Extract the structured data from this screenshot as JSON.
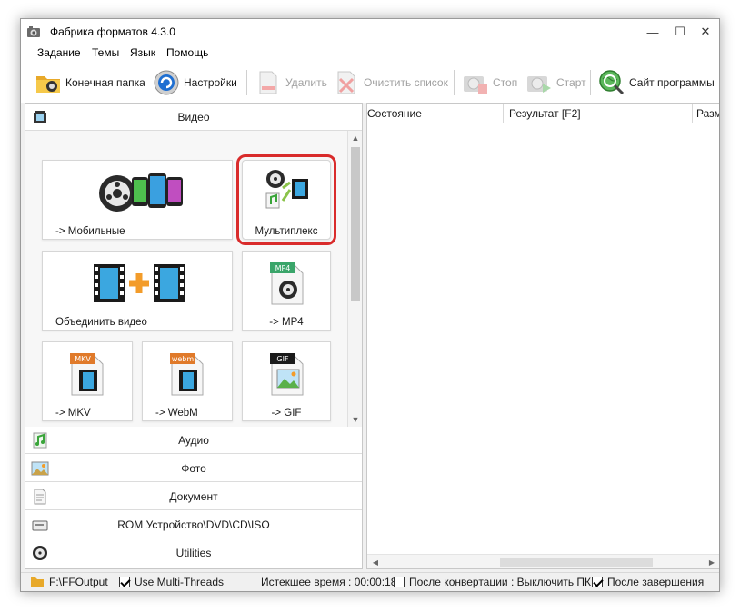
{
  "window": {
    "title": "Фабрика форматов 4.3.0",
    "controls": {
      "minimize": "—",
      "maximize": "☐",
      "close": "✕"
    }
  },
  "menu": [
    "Задание",
    "Темы",
    "Язык",
    "Помощь"
  ],
  "toolbar": {
    "output_folder": "Конечная папка",
    "settings": "Настройки",
    "delete": "Удалить",
    "clear_list": "Очистить список",
    "stop": "Стоп",
    "start": "Старт",
    "website": "Сайт программы"
  },
  "categories": {
    "video": "Видео",
    "audio": "Аудио",
    "photo": "Фото",
    "document": "Документ",
    "rom": "ROM Устройство\\DVD\\CD\\ISO",
    "utilities": "Utilities"
  },
  "video_tiles": {
    "mobile": "-> Мобильные",
    "multiplex": "Мультиплекс",
    "join": "Объединить видео",
    "mp4": "-> MP4",
    "mkv": "-> MKV",
    "webm": "-> WebM",
    "gif": "-> GIF",
    "badge_mp4": "MP4",
    "badge_mkv": "MKV",
    "badge_webm": "webm",
    "badge_gif": "GIF"
  },
  "task_columns": [
    "Состояние",
    "Результат [F2]",
    "Разм"
  ],
  "status": {
    "output_path": "F:\\FFOutput",
    "multithreads": "Use Multi-Threads",
    "elapsed": "Истекшее время : 00:00:18",
    "after_convert": "После конвертации : Выключить ПК",
    "after_finish": "После завершения"
  },
  "colors": {
    "highlight": "#d92b2b",
    "film": "#1a1a1a",
    "film_blue": "#3ba7e0",
    "plus": "#f39c2a",
    "green": "#3aa53a"
  }
}
